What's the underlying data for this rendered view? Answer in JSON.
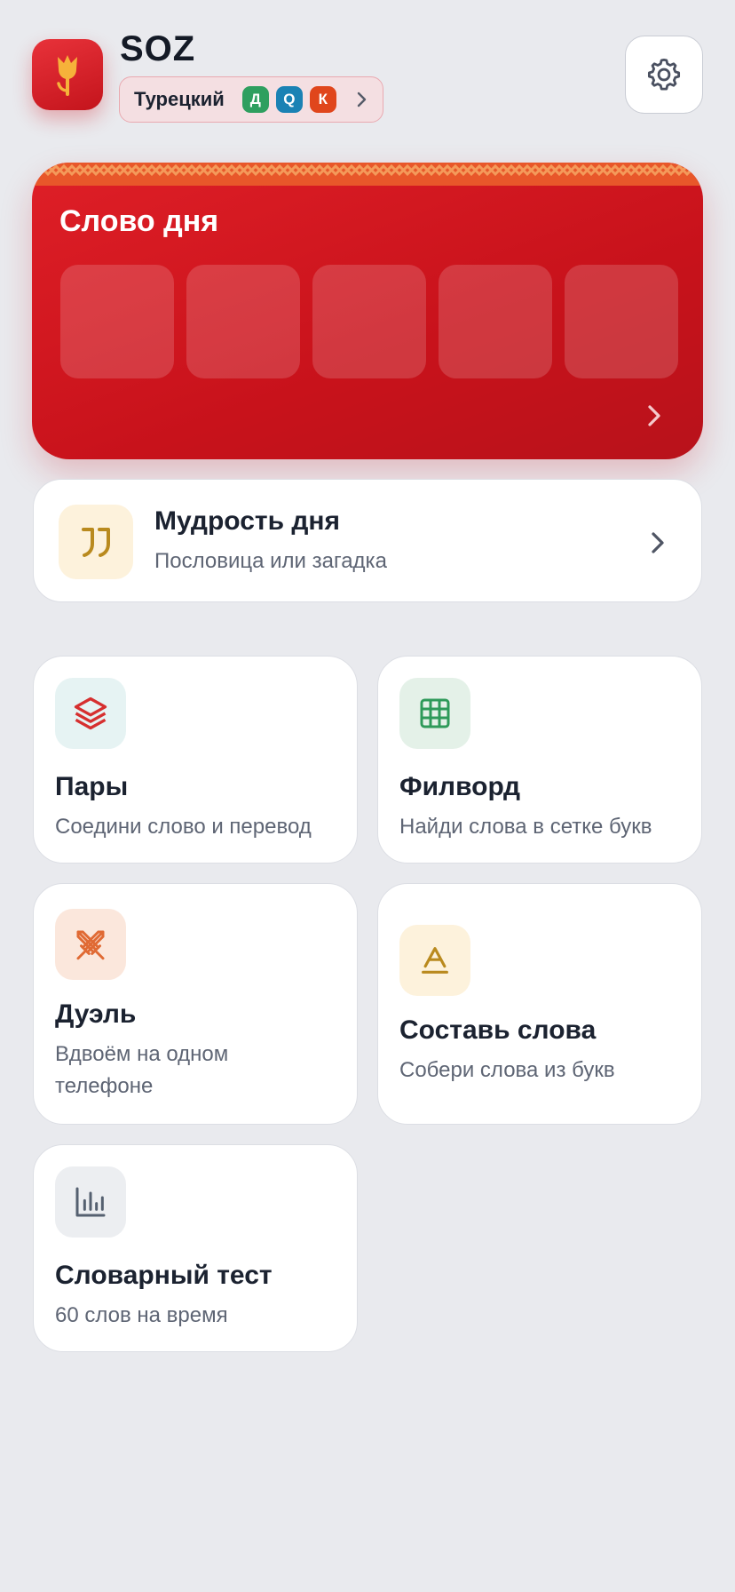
{
  "header": {
    "app_name": "SOZ",
    "language": {
      "name": "Турецкий",
      "badges": [
        {
          "letter": "Д",
          "color": "#2e9f5f"
        },
        {
          "letter": "Q",
          "color": "#1a82b4"
        },
        {
          "letter": "К",
          "color": "#e0461c"
        }
      ]
    },
    "logo_icon": "tulip-icon",
    "settings_icon": "gear-icon"
  },
  "word_of_day": {
    "title": "Слово дня",
    "tile_count": 5,
    "accent": "#d81a22"
  },
  "wisdom": {
    "title": "Мудрость дня",
    "subtitle": "Пословица или загадка",
    "icon": "quote-icon"
  },
  "games": [
    {
      "title": "Пары",
      "subtitle": "Соедини слово и перевод",
      "icon": "layers-icon"
    },
    {
      "title": "Филворд",
      "subtitle": "Найди слова в сетке букв",
      "icon": "grid-icon"
    },
    {
      "title": "Дуэль",
      "subtitle": "Вдвоём на одном телефоне",
      "icon": "swords-icon"
    },
    {
      "title": "Составь слова",
      "subtitle": "Собери слова из букв",
      "icon": "letter-a-icon"
    },
    {
      "title": "Словарный тест",
      "subtitle": "60 слов на время",
      "icon": "bar-chart-icon"
    }
  ]
}
